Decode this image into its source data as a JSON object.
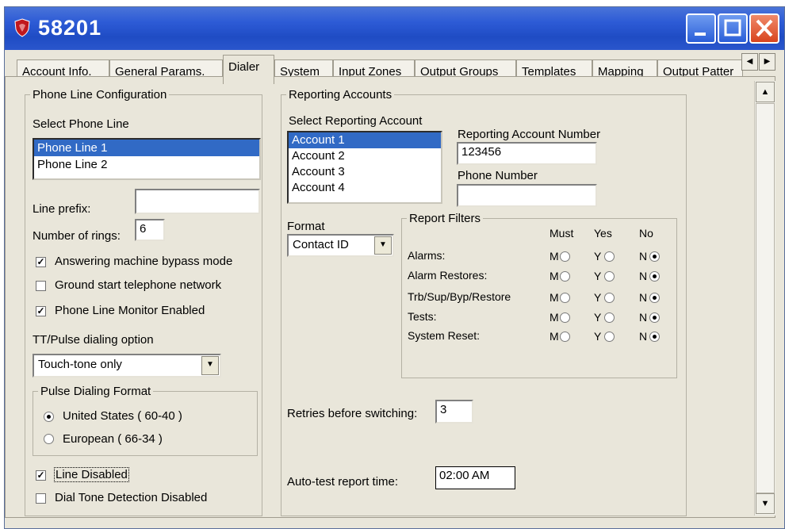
{
  "window": {
    "title": "58201",
    "colors": {
      "titlebar": "#2d5bd6",
      "selection": "#316ac5",
      "face": "#e9e6da"
    }
  },
  "tabs": [
    "Account Info.",
    "General Params.",
    "Dialer",
    "System",
    "Input Zones",
    "Output Groups",
    "Templates",
    "Mapping",
    "Output Patter"
  ],
  "active_tab": "Dialer",
  "phone_config": {
    "legend": "Phone Line Configuration",
    "select_label": "Select Phone Line",
    "lines": [
      "Phone Line 1",
      "Phone Line 2"
    ],
    "selected_line": "Phone Line 1",
    "line_prefix_label": "Line prefix:",
    "line_prefix_value": "",
    "rings_label": "Number of rings:",
    "rings_value": "6",
    "answering_label": "Answering machine bypass mode",
    "answering_checked": true,
    "ground_label": "Ground start telephone network",
    "ground_checked": false,
    "monitor_label": "Phone Line Monitor Enabled",
    "monitor_checked": true,
    "dialing_option_label": "TT/Pulse dialing option",
    "dialing_option_value": "Touch-tone only",
    "pulse_legend": "Pulse Dialing Format",
    "pulse_us_label": "United States ( 60-40 )",
    "pulse_eu_label": "European ( 66-34 )",
    "pulse_selected": "United States ( 60-40 )",
    "line_disabled_label": "Line Disabled",
    "line_disabled_checked": true,
    "dial_tone_label": "Dial Tone Detection Disabled",
    "dial_tone_checked": false
  },
  "reporting": {
    "legend": "Reporting Accounts",
    "select_label": "Select Reporting Account",
    "accounts": [
      "Account 1",
      "Account 2",
      "Account 3",
      "Account 4"
    ],
    "selected_account": "Account 1",
    "account_number_label": "Reporting Account Number",
    "account_number_value": "123456",
    "phone_number_label": "Phone Number",
    "phone_number_value": "",
    "format_label": "Format",
    "format_value": "Contact ID",
    "filters": {
      "legend": "Report Filters",
      "columns": [
        "Must",
        "Yes",
        "No"
      ],
      "letters": [
        "M",
        "Y",
        "N"
      ],
      "rows": [
        {
          "label": "Alarms:",
          "selected": "No"
        },
        {
          "label": "Alarm Restores:",
          "selected": "No"
        },
        {
          "label": "Trb/Sup/Byp/Restore",
          "selected": "No"
        },
        {
          "label": "Tests:",
          "selected": "No"
        },
        {
          "label": "System Reset:",
          "selected": "No"
        }
      ]
    },
    "retries_label": "Retries before switching:",
    "retries_value": "3",
    "autotest_label": "Auto-test report time:",
    "autotest_value": "02:00 AM"
  }
}
